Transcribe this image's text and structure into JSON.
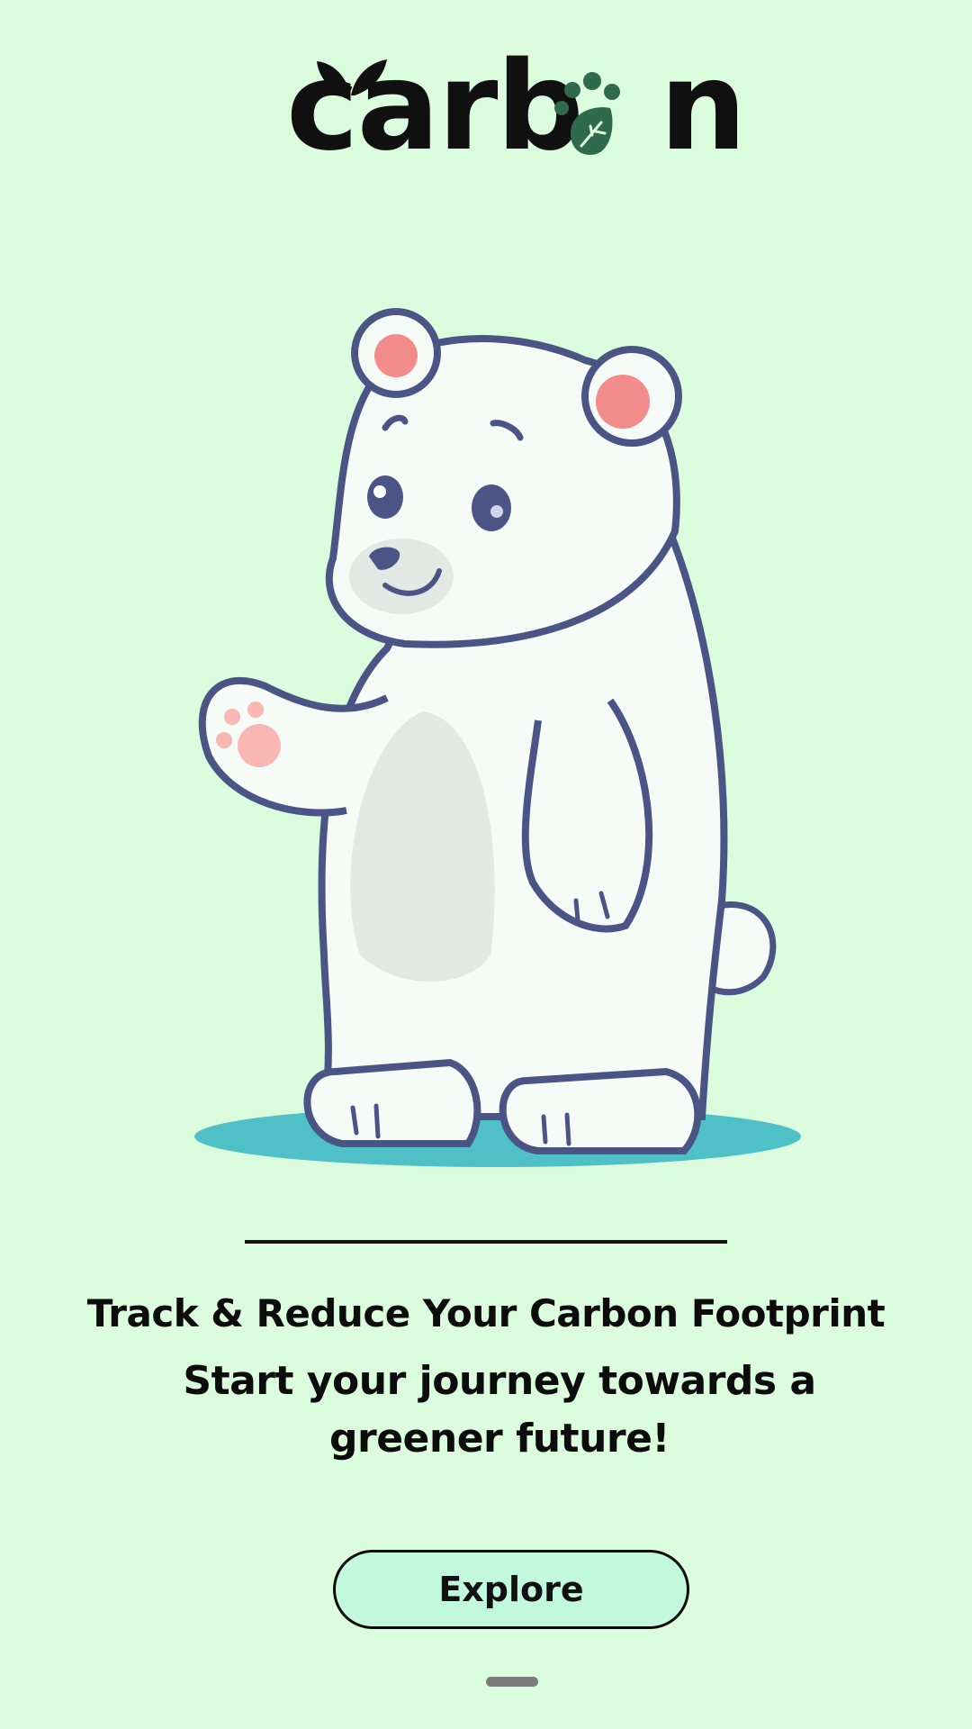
{
  "logo": {
    "prefix": "carb",
    "suffix": "n",
    "leaf_icon": "leaf-icon",
    "paw_icon": "paw-leaf-icon",
    "accent_color": "#2f6a4c"
  },
  "illustration": {
    "icon": "polar-bear-waving-illustration",
    "ground_color": "#4fc0c6"
  },
  "headline": "Track & Reduce Your Carbon Footprint",
  "subline": "Start your journey towards a greener future!",
  "explore_button": {
    "label": "Explore",
    "background": "#c2f8dc"
  },
  "background_color": "#dcfddd"
}
